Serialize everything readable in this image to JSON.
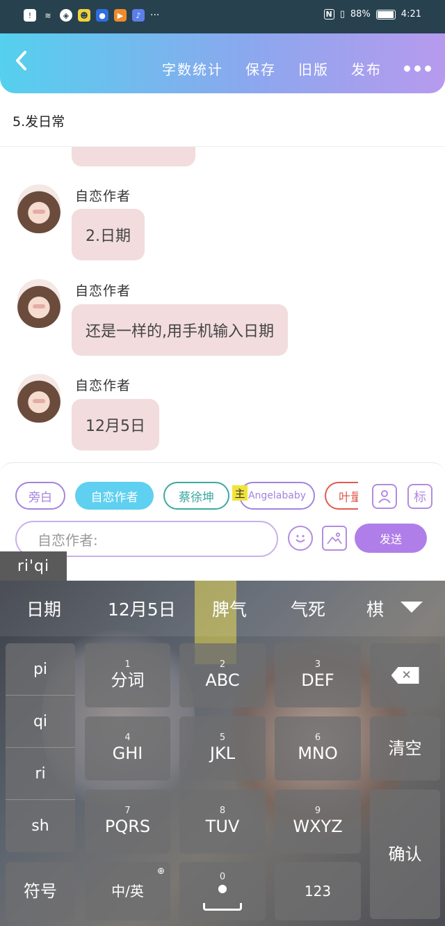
{
  "status_bar": {
    "battery": "88%",
    "time": "4:21",
    "battery_level": 0.88,
    "left_icons": [
      "notification-icon",
      "wifi-icon",
      "location-icon",
      "app-icon-1",
      "app-icon-2",
      "video-icon",
      "music-icon",
      "more-dots-icon"
    ],
    "right_icons": [
      "nfc-icon",
      "vibrate-icon",
      "battery-icon"
    ]
  },
  "top_bar": {
    "back_icon": "chevron-left-icon",
    "actions": [
      "字数统计",
      "保存",
      "旧版",
      "发布"
    ],
    "more_icon": "more-dots-icon"
  },
  "chapter_title": "5.发日常",
  "messages": [
    {
      "sender": "自恋作者",
      "text": "2.日期"
    },
    {
      "sender": "自恋作者",
      "text": "还是一样的,用手机输入日期"
    },
    {
      "sender": "自恋作者",
      "text": "12月5日"
    }
  ],
  "panel": {
    "chips": [
      "旁白",
      "自恋作者",
      "蔡徐坤",
      "Angelababy",
      "叶量"
    ],
    "main_badge": "主",
    "mark_button": "标",
    "input_placeholder": "自恋作者:",
    "send_label": "发送",
    "colors": {
      "accent": "#b07ee8",
      "active_chip": "#5fd0f0",
      "teal": "#3aa9a0",
      "red": "#e05a50",
      "purple": "#a384de"
    }
  },
  "ime": {
    "composing": "ri'qi",
    "candidates": [
      "日期",
      "12月5日",
      "脾气",
      "气死",
      "棋"
    ],
    "pinyin_list": [
      "pi",
      "qi",
      "ri",
      "sh"
    ],
    "keys": [
      {
        "num": "1",
        "label": "分词"
      },
      {
        "num": "2",
        "label": "ABC"
      },
      {
        "num": "3",
        "label": "DEF"
      },
      {
        "num": "4",
        "label": "GHI"
      },
      {
        "num": "5",
        "label": "JKL"
      },
      {
        "num": "6",
        "label": "MNO"
      },
      {
        "num": "7",
        "label": "PQRS"
      },
      {
        "num": "8",
        "label": "TUV"
      },
      {
        "num": "9",
        "label": "WXYZ"
      }
    ],
    "clear_label": "清空",
    "confirm_label": "确认",
    "symbol_label": "符号",
    "lang_label": "中/英",
    "space_num": "0",
    "num_label": "123"
  }
}
